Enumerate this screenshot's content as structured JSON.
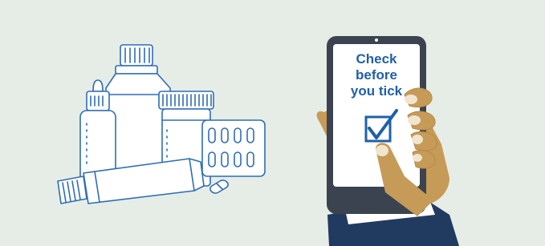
{
  "illustration": {
    "phone_message": {
      "line1": "Check",
      "line2": "before",
      "line3": "you tick"
    },
    "colors": {
      "background": "#e6ede6",
      "outline": "#2f6db5",
      "phone_body": "#3c4350",
      "phone_screen": "#ffffff",
      "message_text": "#1f60a8",
      "skin": "#c69b58",
      "sleeve": "#213a5f",
      "cuff": "#ffffff"
    },
    "icons": [
      "medicine-bottles-icon",
      "eye-dropper-bottle-icon",
      "pill-jar-icon",
      "blister-pack-icon",
      "ointment-tube-icon",
      "capsule-icon",
      "smartphone-icon",
      "checkbox-tick-icon",
      "hand-icon"
    ]
  }
}
